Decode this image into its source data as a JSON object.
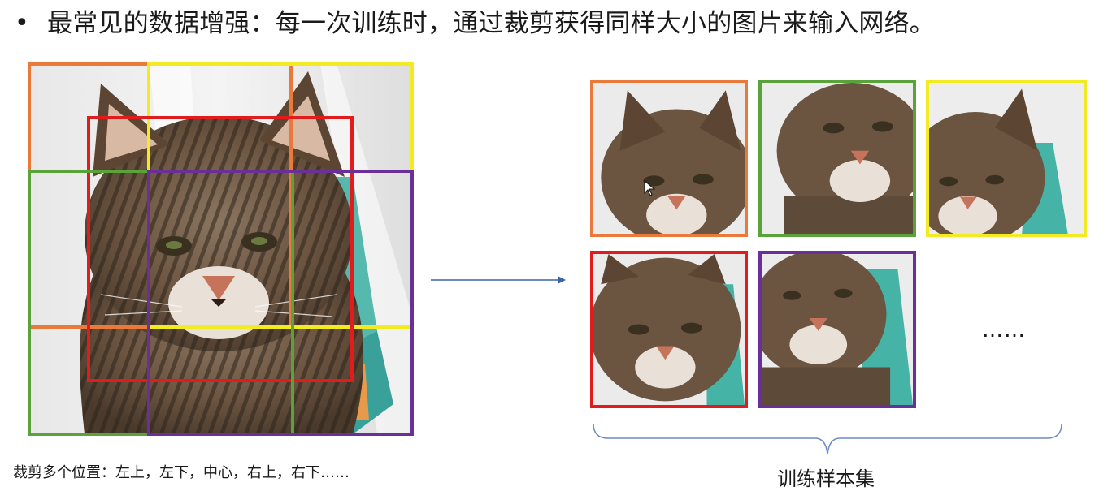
{
  "slide": {
    "bullet_icon": "bullet-dot",
    "headline": "最常见的数据增强：每一次训练时，通过裁剪获得同样大小的图片来输入网络。",
    "left_caption": "裁剪多个位置：左上，左下，中心，右上，右下……",
    "right_caption": "训练样本集",
    "ellipsis": "……"
  },
  "crops": [
    {
      "name": "top-left",
      "color": "#ea7a3b"
    },
    {
      "name": "top-right",
      "color": "#f2ea22"
    },
    {
      "name": "center",
      "color": "#e01c1c"
    },
    {
      "name": "bottom-left",
      "color": "#5aa23a"
    },
    {
      "name": "bottom-right",
      "color": "#6b2f9a"
    }
  ],
  "samples": [
    {
      "name": "top-left",
      "color": "#ea7a3b"
    },
    {
      "name": "bottom-left",
      "color": "#5aa23a"
    },
    {
      "name": "top-right",
      "color": "#f2ea22"
    },
    {
      "name": "center",
      "color": "#e01c1c"
    },
    {
      "name": "bottom-right",
      "color": "#6b2f9a"
    }
  ],
  "arrow_color": "#3a63a8",
  "icons": {
    "arrow": "arrow-right-icon",
    "brace": "curly-brace-icon",
    "cursor": "mouse-pointer-icon"
  }
}
